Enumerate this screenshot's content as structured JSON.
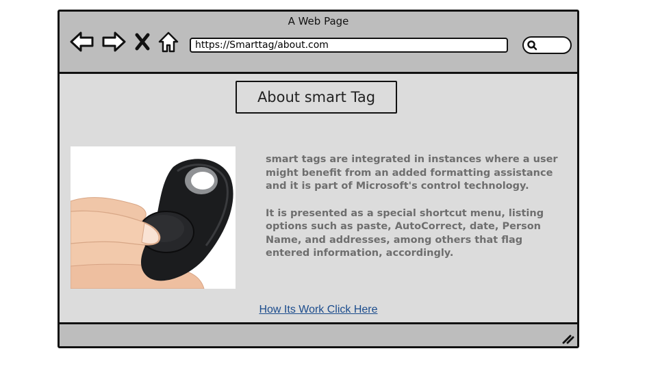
{
  "window": {
    "title": "A Web Page"
  },
  "toolbar": {
    "back_icon": "back-arrow-icon",
    "forward_icon": "forward-arrow-icon",
    "stop_icon": "close-icon",
    "home_icon": "home-icon"
  },
  "address_bar": {
    "value": "https://Smarttag/about.com"
  },
  "search": {
    "icon": "search-icon",
    "value": ""
  },
  "page": {
    "heading": "About smart Tag",
    "image": {
      "subject": "smart-tag-device-in-hand"
    },
    "paragraphs": [
      "smart tags are integrated in instances where a user might benefit from an added formatting assistance and it is part of Microsoft's control technology.",
      "It is presented as a special shortcut menu, listing options such as paste, AutoCorrect, date, Person Name, and addresses, among others that flag entered information, accordingly."
    ],
    "link_text": "How Its Work Click Here"
  },
  "colors": {
    "chrome": "#bdbdbd",
    "content_bg": "#dcdcdc",
    "body_text": "#6e6e6e",
    "link": "#1a4b8c"
  }
}
